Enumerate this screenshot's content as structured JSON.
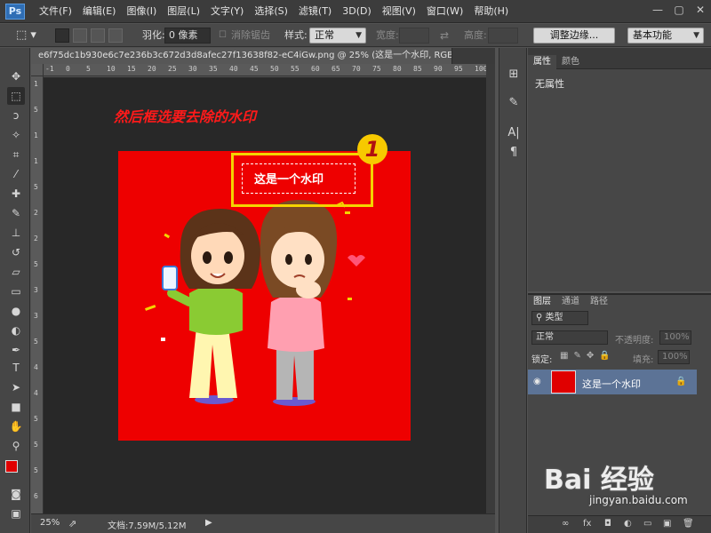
{
  "app": {
    "logo": "Ps"
  },
  "menubar": {
    "items": [
      "文件(F)",
      "编辑(E)",
      "图像(I)",
      "图层(L)",
      "文字(Y)",
      "选择(S)",
      "滤镜(T)",
      "3D(D)",
      "视图(V)",
      "窗口(W)",
      "帮助(H)"
    ],
    "window_controls": [
      "—",
      "▢",
      "✕"
    ]
  },
  "options_bar": {
    "feather_label": "羽化:",
    "feather_value": "0 像素",
    "antialias_label": "消除锯齿",
    "style_label": "样式:",
    "style_value": "正常",
    "width_label": "宽度:",
    "height_label": "高度:",
    "refine_edge_button": "调整边缘...",
    "workspace_value": "基本功能"
  },
  "tools": [
    "marquee-icon",
    "move-icon",
    "lasso-icon",
    "magic-wand-icon",
    "crop-icon",
    "eyedropper-icon",
    "healing-icon",
    "brush-icon",
    "stamp-icon",
    "history-brush-icon",
    "eraser-icon",
    "gradient-icon",
    "blur-icon",
    "dodge-icon",
    "pen-icon",
    "type-icon",
    "path-select-icon",
    "rectangle-icon",
    "hand-icon",
    "zoom-icon"
  ],
  "document": {
    "tab_title": "e6f75dc1b930e6c7e236b3c672d3d8afec27f13638f82-eC4iGw.png @ 25% (这是一个水印, RGB/8#) *",
    "ruler_top": [
      "-1",
      "0",
      "5",
      "10",
      "15",
      "20",
      "25",
      "30",
      "35",
      "40",
      "45",
      "50",
      "55",
      "60",
      "65",
      "70",
      "75",
      "80",
      "85",
      "90",
      "95",
      "100"
    ],
    "ruler_left": [
      "1",
      "5",
      "1",
      "1",
      "5",
      "2",
      "2",
      "5",
      "3",
      "3",
      "5",
      "4",
      "4",
      "5",
      "5",
      "5",
      "6"
    ],
    "caption": "然后框选要去除的水印",
    "watermark_text": "这是一个水印",
    "step_number": "1"
  },
  "status": {
    "zoom": "25%",
    "doc_info": "文档:7.59M/5.12M"
  },
  "properties": {
    "tabs": [
      "属性",
      "颜色"
    ],
    "empty_text": "无属性"
  },
  "layers": {
    "tabs": [
      "图层",
      "通道",
      "路径"
    ],
    "filter_kind": "类型",
    "blend_mode": "正常",
    "opacity_label": "不透明度:",
    "opacity_value": "100%",
    "lock_label": "锁定:",
    "fill_label": "填充:",
    "fill_value": "100%",
    "layer_name": "这是一个水印"
  },
  "branding": {
    "logo_text": "Bai 经验",
    "url": "jingyan.baidu.com"
  }
}
